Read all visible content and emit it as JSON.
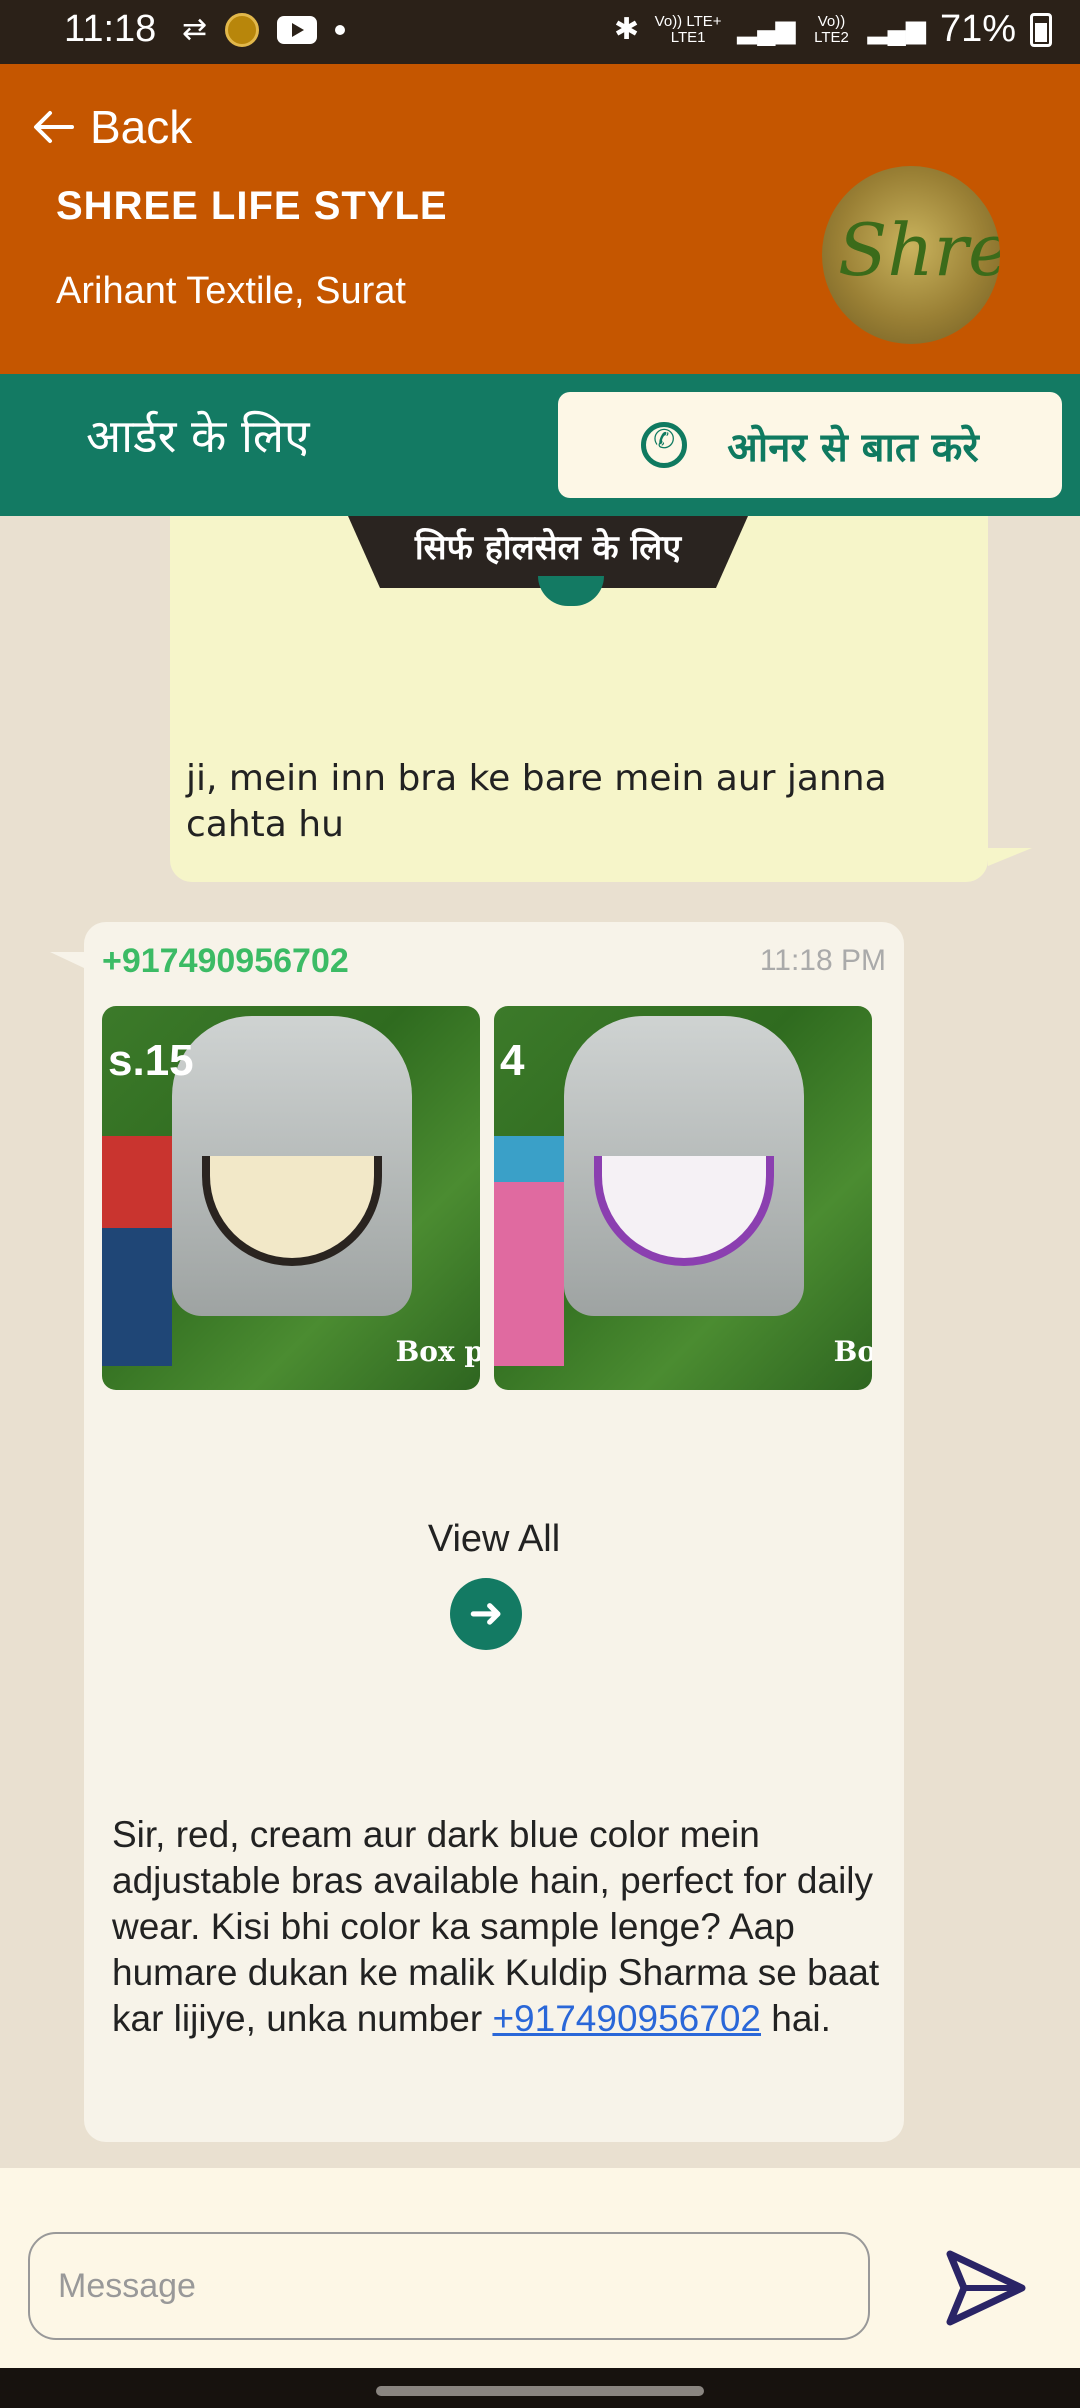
{
  "status_bar": {
    "time": "11:18",
    "battery": "71%",
    "network_1": "Vo)) LTE+ LTE1",
    "network_2": "Vo)) LTE2"
  },
  "header": {
    "back_label": "Back",
    "shop_name": "SHREE LIFE STYLE",
    "shop_location": "Arihant Textile, Surat",
    "logo_text": "Shree"
  },
  "order_bar": {
    "label": "आर्डर के लिए",
    "owner_button_label": "ओनर से बात करे"
  },
  "chat": {
    "outgoing": {
      "tag": "सिर्फ होलसेल के लिए",
      "text": "ji, mein inn bra ke bare mein aur janna cahta hu"
    },
    "incoming": {
      "sender": "+917490956702",
      "time": "11:18 PM",
      "products": [
        {
          "price_label": "s.15",
          "box_label": "Box p"
        },
        {
          "price_label": "4",
          "box_label": "Bo"
        }
      ],
      "view_all_label": "View All",
      "reply_text_before": "Sir, red, cream aur dark blue color mein adjustable bras available hain, perfect for daily wear. Kisi bhi color ka sample lenge? Aap humare dukan ke malik Kuldip Sharma se baat kar lijiye, unka number ",
      "reply_phone": "+917490956702",
      "reply_text_after": " hai."
    }
  },
  "composer": {
    "placeholder": "Message"
  },
  "colors": {
    "header": "#c55600",
    "order_bar": "#137a63",
    "sender": "#3cbb65"
  }
}
